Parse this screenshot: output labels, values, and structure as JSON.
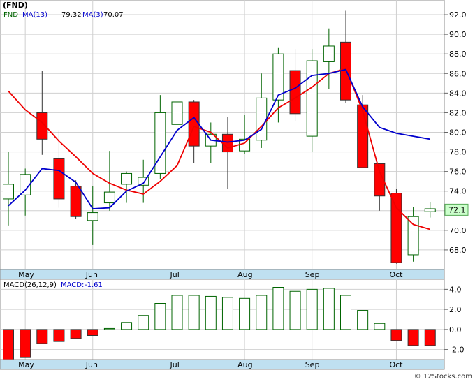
{
  "chart_data": [
    {
      "type": "candlestick",
      "symbol": "(FND)",
      "legend": [
        {
          "name": "FND",
          "label": "FND",
          "value": "",
          "color": "#006400"
        },
        {
          "name": "MA(13)",
          "label": "MA(13)",
          "value": "79.32",
          "color": "#ff0000"
        },
        {
          "name": "MA(3)",
          "label": "MA(3)",
          "value": "70.07",
          "color": "#0000cc"
        }
      ],
      "x_labels": [
        "May",
        "Jun",
        "Jul",
        "Aug",
        "Sep",
        "Oct"
      ],
      "x_label_index": [
        1,
        5,
        10,
        14,
        18,
        23
      ],
      "ylim": [
        66.0,
        93.5
      ],
      "yticks": [
        68.0,
        70.0,
        72.0,
        74.0,
        76.0,
        78.0,
        80.0,
        82.0,
        84.0,
        86.0,
        88.0,
        90.0,
        92.0
      ],
      "ytick_labels": [
        "68.0",
        "70.0",
        "72.0",
        "74.0",
        "76.0",
        "78.0",
        "80.0",
        "82.0",
        "84.0",
        "86.0",
        "88.0",
        "90.0",
        "92.0"
      ],
      "last_price": "72.1",
      "candles": [
        {
          "o": 73.2,
          "h": 78.0,
          "l": 70.5,
          "c": 74.7
        },
        {
          "o": 73.6,
          "h": 76.3,
          "l": 71.5,
          "c": 75.7
        },
        {
          "o": 82.0,
          "h": 86.3,
          "l": 77.7,
          "c": 79.3
        },
        {
          "o": 77.3,
          "h": 80.2,
          "l": 72.3,
          "c": 73.2
        },
        {
          "o": 74.5,
          "h": 75.1,
          "l": 71.2,
          "c": 71.4
        },
        {
          "o": 71.0,
          "h": 74.5,
          "l": 68.5,
          "c": 71.8
        },
        {
          "o": 72.8,
          "h": 78.1,
          "l": 72.0,
          "c": 73.9
        },
        {
          "o": 74.7,
          "h": 76.0,
          "l": 72.8,
          "c": 75.8
        },
        {
          "o": 74.6,
          "h": 77.2,
          "l": 72.8,
          "c": 75.4
        },
        {
          "o": 75.8,
          "h": 83.8,
          "l": 75.2,
          "c": 82.0
        },
        {
          "o": 80.8,
          "h": 86.5,
          "l": 80.0,
          "c": 83.1
        },
        {
          "o": 83.1,
          "h": 83.3,
          "l": 76.9,
          "c": 78.6
        },
        {
          "o": 78.6,
          "h": 81.0,
          "l": 76.9,
          "c": 79.8
        },
        {
          "o": 79.8,
          "h": 81.6,
          "l": 74.2,
          "c": 78.0
        },
        {
          "o": 78.1,
          "h": 81.8,
          "l": 77.8,
          "c": 79.3
        },
        {
          "o": 79.2,
          "h": 86.0,
          "l": 78.4,
          "c": 83.5
        },
        {
          "o": 83.3,
          "h": 88.6,
          "l": 81.0,
          "c": 88.0
        },
        {
          "o": 86.3,
          "h": 88.5,
          "l": 81.1,
          "c": 81.9
        },
        {
          "o": 79.6,
          "h": 88.5,
          "l": 78.0,
          "c": 87.3
        },
        {
          "o": 87.2,
          "h": 90.6,
          "l": 84.4,
          "c": 88.8
        },
        {
          "o": 89.2,
          "h": 92.4,
          "l": 83.0,
          "c": 83.3
        },
        {
          "o": 82.8,
          "h": 83.8,
          "l": 76.4,
          "c": 76.4
        },
        {
          "o": 76.8,
          "h": 76.8,
          "l": 72.0,
          "c": 73.5
        },
        {
          "o": 73.8,
          "h": 74.2,
          "l": 66.6,
          "c": 66.7
        },
        {
          "o": 67.5,
          "h": 72.4,
          "l": 66.8,
          "c": 71.4
        },
        {
          "o": 71.9,
          "h": 72.9,
          "l": 71.3,
          "c": 72.2
        }
      ],
      "ma13": [
        {
          "i": 0,
          "v": 84.2
        },
        {
          "i": 1,
          "v": 82.3
        },
        {
          "i": 2,
          "v": 81.0
        },
        {
          "i": 3,
          "v": 79.1
        },
        {
          "i": 4,
          "v": 77.5
        },
        {
          "i": 5,
          "v": 75.8
        },
        {
          "i": 6,
          "v": 74.8
        },
        {
          "i": 7,
          "v": 74.1
        },
        {
          "i": 8,
          "v": 73.7
        },
        {
          "i": 9,
          "v": 75.0
        },
        {
          "i": 10,
          "v": 76.6
        },
        {
          "i": 11,
          "v": 80.6
        },
        {
          "i": 12,
          "v": 80.0
        },
        {
          "i": 13,
          "v": 78.4
        },
        {
          "i": 14,
          "v": 78.9
        },
        {
          "i": 15,
          "v": 80.6
        },
        {
          "i": 16,
          "v": 82.5
        },
        {
          "i": 17,
          "v": 83.5
        },
        {
          "i": 18,
          "v": 84.6
        },
        {
          "i": 19,
          "v": 86.0
        },
        {
          "i": 20,
          "v": 86.5
        },
        {
          "i": 21,
          "v": 82.2
        },
        {
          "i": 22,
          "v": 76.0
        },
        {
          "i": 23,
          "v": 72.3
        },
        {
          "i": 24,
          "v": 70.6
        },
        {
          "i": 25,
          "v": 70.1
        }
      ],
      "ma3": [
        {
          "i": 0,
          "v": 72.5
        },
        {
          "i": 1,
          "v": 74.1
        },
        {
          "i": 2,
          "v": 76.3
        },
        {
          "i": 3,
          "v": 76.1
        },
        {
          "i": 4,
          "v": 74.9
        },
        {
          "i": 5,
          "v": 72.2
        },
        {
          "i": 6,
          "v": 72.3
        },
        {
          "i": 7,
          "v": 74.0
        },
        {
          "i": 8,
          "v": 74.8
        },
        {
          "i": 9,
          "v": 77.5
        },
        {
          "i": 10,
          "v": 80.2
        },
        {
          "i": 11,
          "v": 81.5
        },
        {
          "i": 12,
          "v": 79.2
        },
        {
          "i": 13,
          "v": 79.0
        },
        {
          "i": 14,
          "v": 79.2
        },
        {
          "i": 15,
          "v": 80.3
        },
        {
          "i": 16,
          "v": 83.8
        },
        {
          "i": 17,
          "v": 84.5
        },
        {
          "i": 18,
          "v": 85.8
        },
        {
          "i": 19,
          "v": 86.0
        },
        {
          "i": 20,
          "v": 86.4
        },
        {
          "i": 21,
          "v": 82.6
        },
        {
          "i": 22,
          "v": 80.5
        },
        {
          "i": 23,
          "v": 79.9
        },
        {
          "i": 24,
          "v": 79.6
        },
        {
          "i": 25,
          "v": 79.3
        }
      ]
    },
    {
      "type": "bar",
      "legend": [
        {
          "name": "MACD(26,12,9)",
          "label": "MACD(26,12,9)",
          "value": "",
          "color": "#000000"
        },
        {
          "name": "MACD",
          "label": "MACD:",
          "value": "-1.61",
          "color": "#0000cc"
        }
      ],
      "x_labels": [
        "May",
        "Jun",
        "Jul",
        "Aug",
        "Sep",
        "Oct"
      ],
      "x_label_index": [
        1,
        5,
        10,
        14,
        18,
        23
      ],
      "ylim": [
        -3.0,
        5.0
      ],
      "yticks": [
        -2.0,
        0.0,
        2.0,
        4.0
      ],
      "ytick_labels": [
        "-2.0",
        "0.0",
        "2.0",
        "4.0"
      ],
      "values": [
        -3.0,
        -2.8,
        -1.4,
        -1.2,
        -0.9,
        -0.6,
        0.1,
        0.7,
        1.4,
        2.6,
        3.4,
        3.4,
        3.3,
        3.2,
        3.1,
        3.4,
        4.2,
        3.8,
        4.0,
        4.1,
        3.4,
        1.9,
        0.6,
        -1.1,
        -1.6,
        -1.6
      ]
    }
  ],
  "footer": {
    "copyright": "© 12Stocks.com"
  }
}
